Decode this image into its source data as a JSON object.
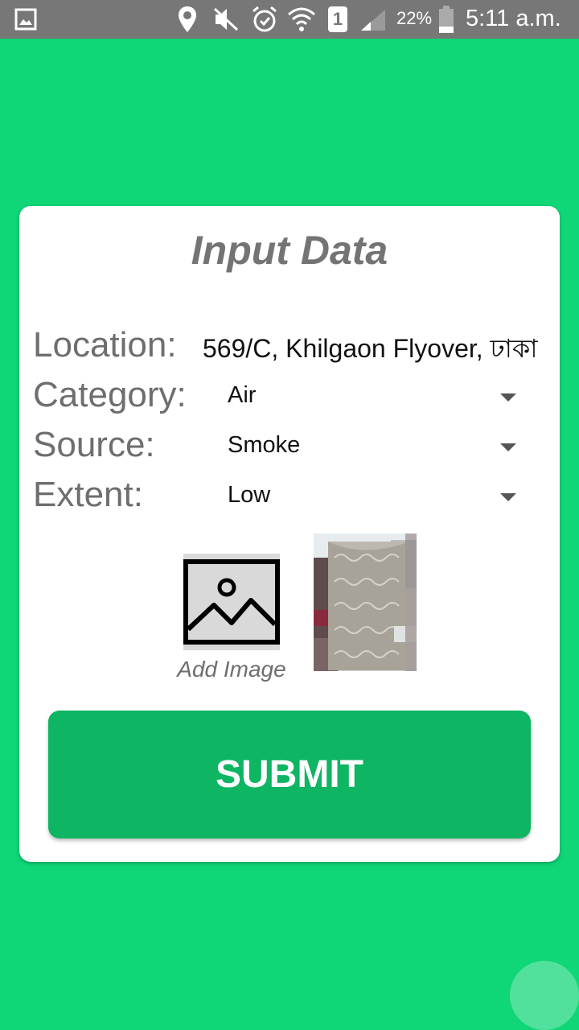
{
  "status_bar": {
    "battery_percent": "22%",
    "time": "5:11 a.m.",
    "sim_slot": "1"
  },
  "form": {
    "title": "Input Data",
    "location": {
      "label": "Location:",
      "value": "569/C, Khilgaon Flyover, ঢাকা"
    },
    "category": {
      "label": "Category:",
      "value": "Air"
    },
    "source": {
      "label": "Source:",
      "value": "Smoke"
    },
    "extent": {
      "label": "Extent:",
      "value": "Low"
    },
    "add_image_label": "Add Image",
    "submit_label": "SUBMIT"
  },
  "colors": {
    "background": "#0fd677",
    "submit": "#0eb562",
    "status_bar": "#777777"
  }
}
